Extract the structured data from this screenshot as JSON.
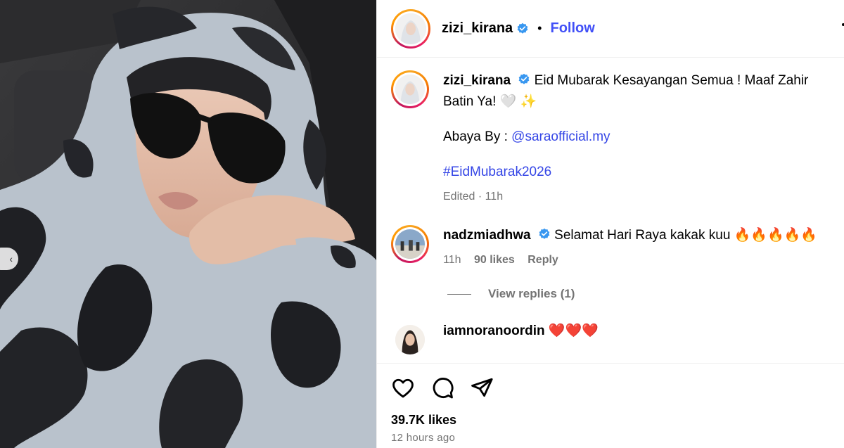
{
  "post": {
    "author": "zizi_kirana",
    "follow_label": "Follow",
    "separator": "•"
  },
  "caption": {
    "username": "zizi_kirana",
    "line1": "Eid Mubarak Kesayangan Semua ! Maaf Zahir Batin Ya! 🤍 ✨",
    "abaya_prefix": "Abaya By : ",
    "abaya_mention": "@saraofficial.my",
    "hashtag": "#EidMubarak2026",
    "meta": "Edited · 11h"
  },
  "comments": [
    {
      "username": "nadzmiadhwa",
      "text": "Selamat Hari Raya kakak kuu 🔥🔥🔥🔥🔥",
      "time": "11h",
      "likes": "90 likes",
      "reply_label": "Reply",
      "view_replies": "View replies (1)"
    },
    {
      "username": "iamnoranoordin",
      "text": "❤️❤️❤️"
    }
  ],
  "actions": {
    "likes": "39.7K likes",
    "posted": "12 hours ago"
  },
  "colors": {
    "accent": "#4150f7",
    "link": "#3546e6",
    "muted": "#737373",
    "verified": "#3897f0"
  }
}
